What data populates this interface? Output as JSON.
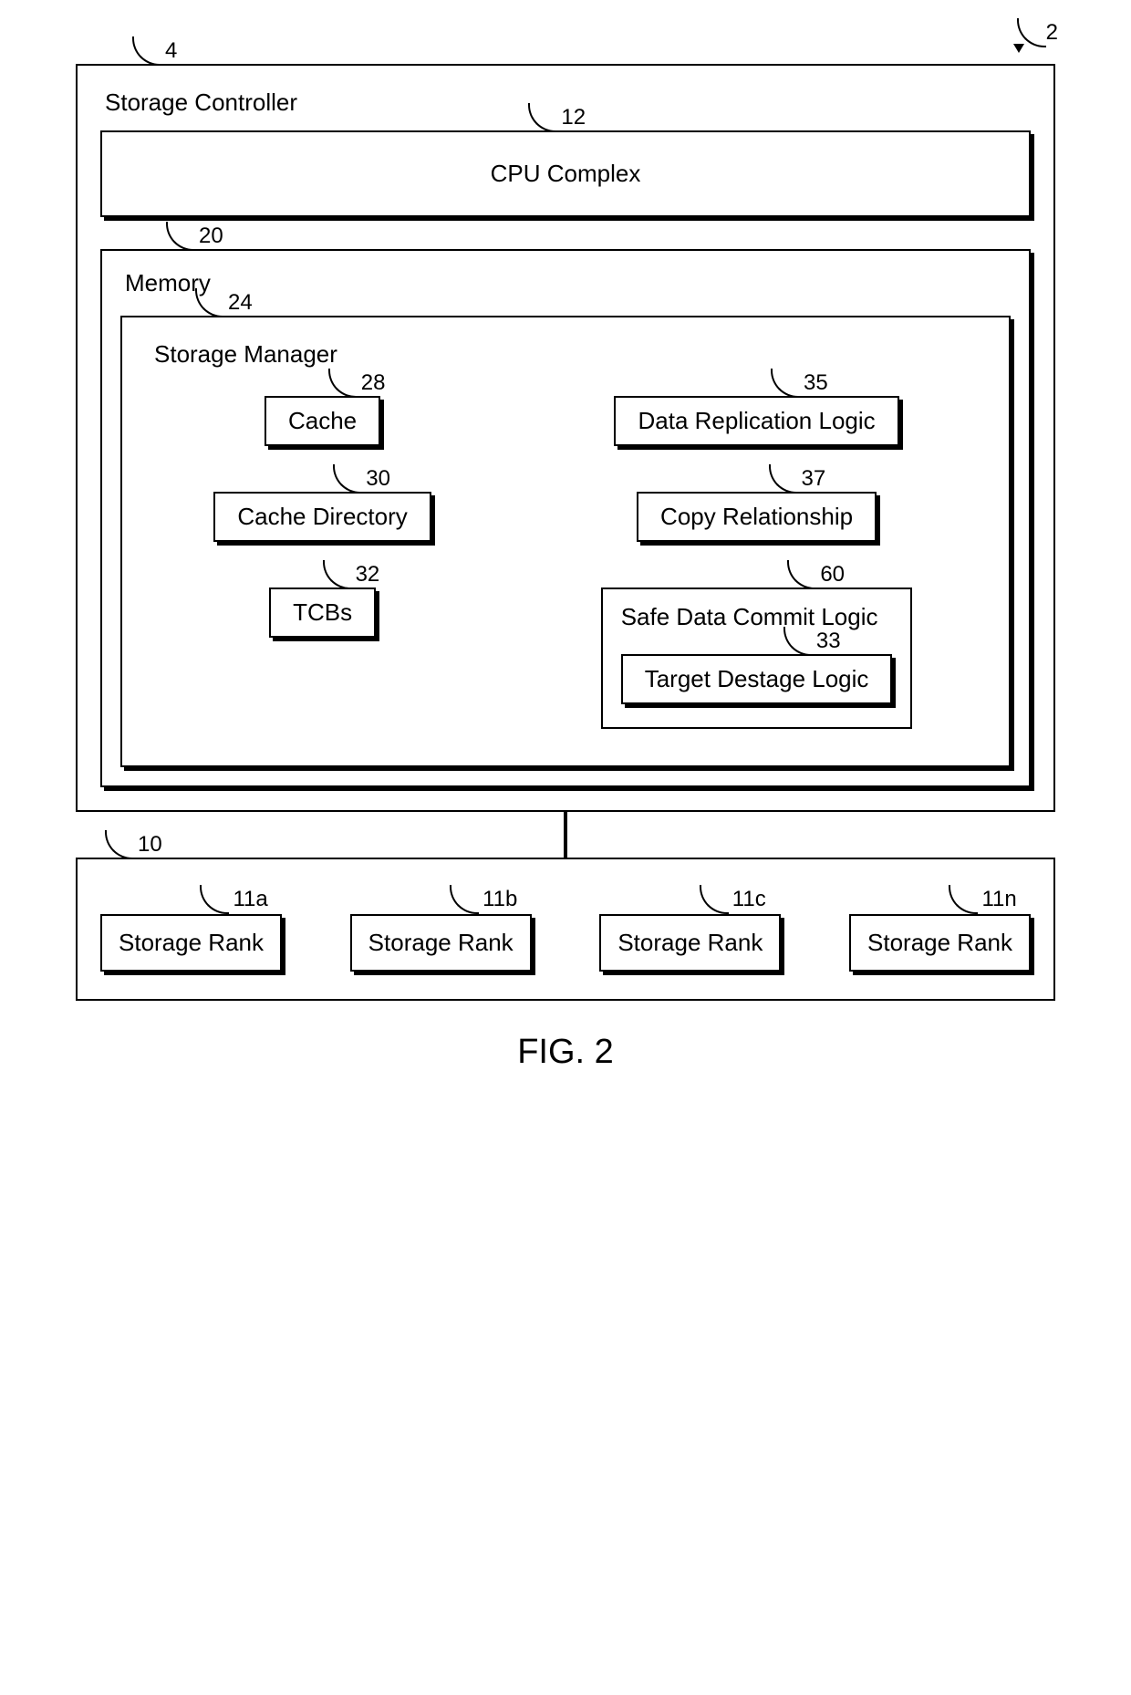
{
  "labels": {
    "ref_2": "2",
    "ref_4": "4",
    "ref_12": "12",
    "ref_20": "20",
    "ref_24": "24",
    "ref_28": "28",
    "ref_35": "35",
    "ref_30": "30",
    "ref_37": "37",
    "ref_32": "32",
    "ref_60": "60",
    "ref_33": "33",
    "ref_10": "10",
    "ref_11a": "11a",
    "ref_11b": "11b",
    "ref_11c": "11c",
    "ref_11n": "11n"
  },
  "boxes": {
    "storage_controller": "Storage Controller",
    "cpu_complex": "CPU Complex",
    "memory": "Memory",
    "storage_manager": "Storage Manager",
    "cache": "Cache",
    "data_replication": "Data Replication Logic",
    "cache_directory": "Cache Directory",
    "copy_relationship": "Copy Relationship",
    "tcbs": "TCBs",
    "safe_data_commit": "Safe Data Commit Logic",
    "target_destage": "Target Destage Logic",
    "storage_rank": "Storage Rank"
  },
  "figure": "FIG. 2"
}
